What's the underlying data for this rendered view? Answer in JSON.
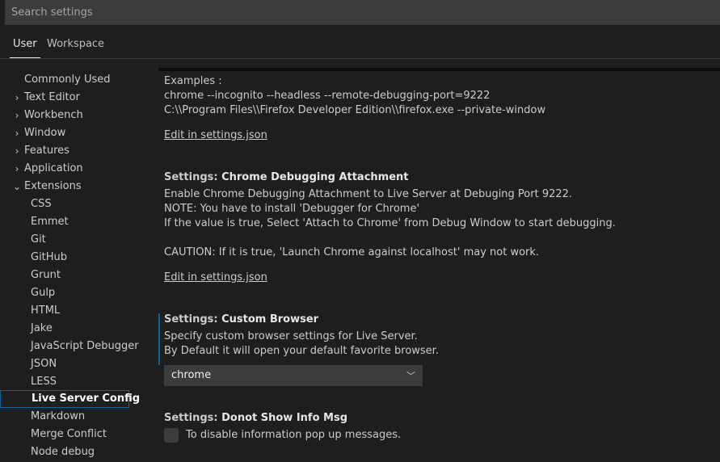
{
  "search": {
    "placeholder": "Search settings"
  },
  "tabs": [
    {
      "label": "User"
    },
    {
      "label": "Workspace"
    }
  ],
  "toc": [
    {
      "label": "Commonly Used",
      "chevron": ""
    },
    {
      "label": "Text Editor",
      "chevron": ">"
    },
    {
      "label": "Workbench",
      "chevron": ">"
    },
    {
      "label": "Window",
      "chevron": ">"
    },
    {
      "label": "Features",
      "chevron": ">"
    },
    {
      "label": "Application",
      "chevron": ">"
    },
    {
      "label": "Extensions",
      "chevron": "v"
    }
  ],
  "extensions": [
    "CSS",
    "Emmet",
    "Git",
    "GitHub",
    "Grunt",
    "Gulp",
    "HTML",
    "Jake",
    "JavaScript Debugger",
    "JSON",
    "LESS",
    "Live Server Config",
    "Markdown",
    "Merge Conflict",
    "Node debug"
  ],
  "content": {
    "examples_label": "Examples :",
    "example1": "chrome --incognito --headless --remote-debugging-port=9222",
    "example2": "C:\\\\Program Files\\\\Firefox Developer Edition\\\\firefox.exe --private-window",
    "edit_link": "Edit in settings.json",
    "setting1": {
      "category": "Settings: ",
      "name": "Chrome Debugging Attachment",
      "desc1": "Enable Chrome Debugging Attachment to Live Server at Debuging Port 9222.",
      "desc2": "NOTE: You have to install 'Debugger for Chrome'",
      "desc3": "If the value is true, Select 'Attach to Chrome' from Debug Window to start debugging.",
      "desc4": "CAUTION: If it is true, 'Launch Chrome against localhost' may not work."
    },
    "setting2": {
      "category": "Settings: ",
      "name": "Custom Browser",
      "desc1": "Specify custom browser settings for Live Server.",
      "desc2": "By Default it will open your default favorite browser.",
      "value": "chrome"
    },
    "setting3": {
      "category": "Settings: ",
      "name": "Donot Show Info Msg",
      "checkbox_label": "To disable information pop up messages."
    }
  },
  "colors": {
    "accent": "#0e639c",
    "background": "#1e1e1e",
    "input": "#3c3c3c"
  }
}
